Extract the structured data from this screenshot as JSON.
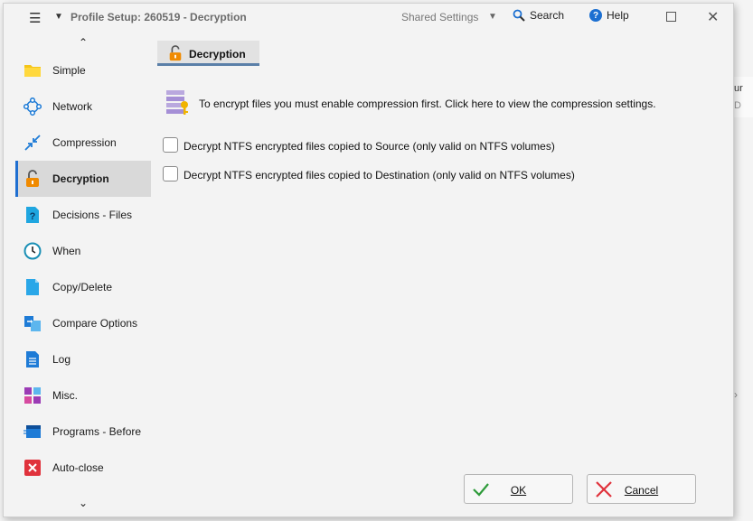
{
  "background": {
    "strip_text_top": "ur",
    "strip_text_bottom": "D"
  },
  "titlebar": {
    "title": "Profile Setup: 260519 - Decryption",
    "shared_settings": "Shared Settings",
    "search_label": "Search",
    "help_label": "Help",
    "menu_icon": "hamburger-icon"
  },
  "sidebar": {
    "items": [
      {
        "label": "Simple",
        "icon": "folder-icon",
        "color": "#f5c518"
      },
      {
        "label": "Network",
        "icon": "network-icon",
        "color": "#1e7bd6"
      },
      {
        "label": "Compression",
        "icon": "compress-icon",
        "color": "#1e7bd6"
      },
      {
        "label": "Decryption",
        "icon": "unlock-icon",
        "color": "#f08a00",
        "active": true
      },
      {
        "label": "Decisions - Files",
        "icon": "question-file-icon",
        "color": "#1fa6e0"
      },
      {
        "label": "When",
        "icon": "clock-icon",
        "color": "#1a8fb5"
      },
      {
        "label": "Copy/Delete",
        "icon": "file-icon",
        "color": "#2aa7e8"
      },
      {
        "label": "Compare Options",
        "icon": "compare-files-icon",
        "color": "#1e7bd6"
      },
      {
        "label": "Log",
        "icon": "log-file-icon",
        "color": "#1e7bd6"
      },
      {
        "label": "Misc.",
        "icon": "misc-blocks-icon",
        "color": "#9b3bb5"
      },
      {
        "label": "Programs - Before",
        "icon": "program-window-icon",
        "color": "#1e7bd6"
      },
      {
        "label": "Auto-close",
        "icon": "close-square-icon",
        "color": "#e0323c"
      }
    ]
  },
  "main": {
    "section_title": "Decryption",
    "info_text": "To encrypt files you must enable compression first. Click here to view the compression settings.",
    "checkboxes": [
      {
        "label": "Decrypt NTFS encrypted files copied to Source (only valid on NTFS volumes)",
        "checked": false
      },
      {
        "label": "Decrypt NTFS encrypted files copied to Destination (only valid on NTFS volumes)",
        "checked": false
      }
    ]
  },
  "buttons": {
    "ok": "OK",
    "cancel": "Cancel"
  },
  "colors": {
    "accent": "#1f6fd1",
    "ok_green": "#2e9b3a",
    "cancel_red": "#e0323c"
  }
}
